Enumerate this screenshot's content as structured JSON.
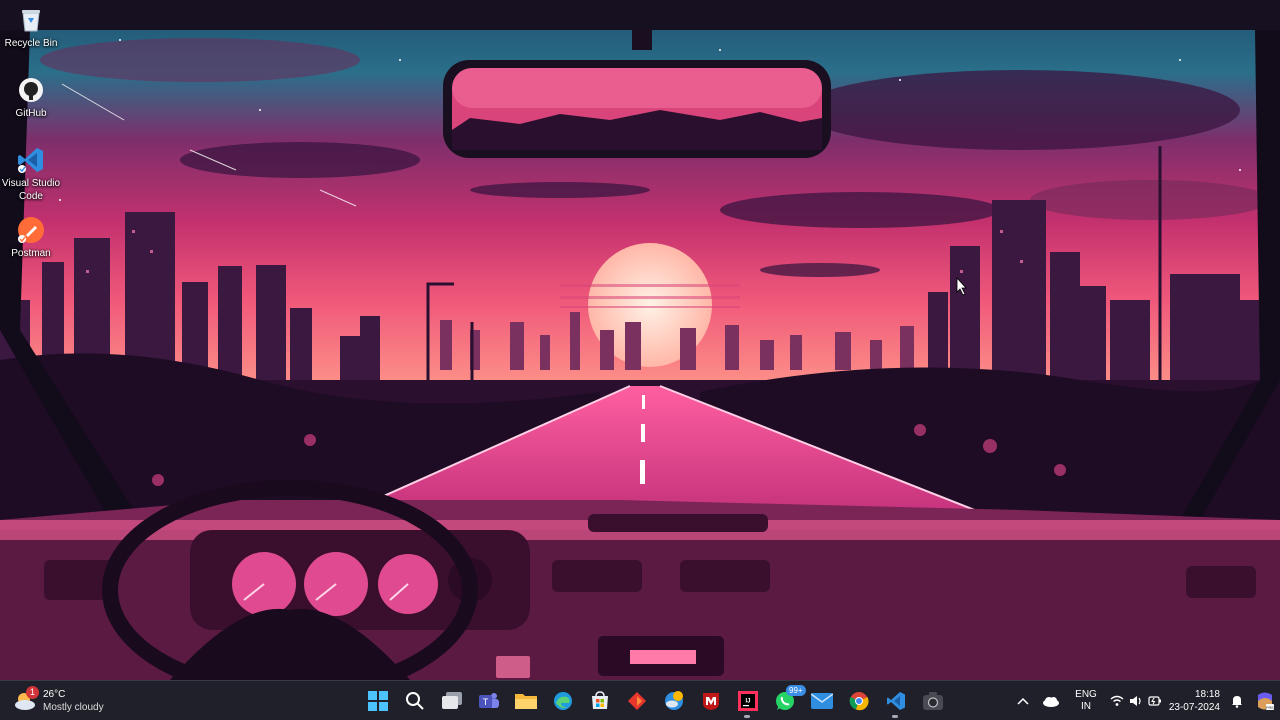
{
  "desktop": {
    "icons": [
      {
        "label": "Recycle Bin",
        "icon": "recycle-bin-icon"
      },
      {
        "label": "GitHub",
        "icon": "github-icon"
      },
      {
        "label": "Visual Studio Code",
        "icon": "vscode-icon"
      },
      {
        "label": "Postman",
        "icon": "postman-icon"
      }
    ],
    "wallpaper": "synthwave-car-dashboard-sunset"
  },
  "taskbar": {
    "weather": {
      "temp": "26°C",
      "desc": "Mostly cloudy",
      "badge": "1"
    },
    "apps": [
      {
        "name": "Start",
        "icon": "windows-start-icon"
      },
      {
        "name": "Search",
        "icon": "search-icon"
      },
      {
        "name": "Task View",
        "icon": "task-view-icon"
      },
      {
        "name": "Teams",
        "icon": "teams-icon"
      },
      {
        "name": "File Explorer",
        "icon": "file-explorer-icon"
      },
      {
        "name": "Edge",
        "icon": "edge-icon"
      },
      {
        "name": "Microsoft Store",
        "icon": "store-icon"
      },
      {
        "name": "Git App",
        "icon": "red-diamond-app-icon"
      },
      {
        "name": "Weather App",
        "icon": "weather-app-icon"
      },
      {
        "name": "McAfee",
        "icon": "mcafee-icon"
      },
      {
        "name": "IntelliJ IDEA",
        "icon": "intellij-icon"
      },
      {
        "name": "WhatsApp",
        "icon": "whatsapp-icon",
        "count": "99+"
      },
      {
        "name": "Mail",
        "icon": "mail-icon"
      },
      {
        "name": "Chrome",
        "icon": "chrome-icon"
      },
      {
        "name": "VS Code",
        "icon": "vscode-taskbar-icon"
      },
      {
        "name": "Camera",
        "icon": "camera-icon"
      }
    ],
    "tray": {
      "lang_line1": "ENG",
      "lang_line2": "IN",
      "time": "18:18",
      "date": "23-07-2024"
    }
  },
  "colors": {
    "taskbar_bg": "#20202a",
    "accent": "#3a8ee6",
    "sky_top": "#2a6f8a",
    "sky_mid": "#c2306e",
    "sun": "#ffd6c8"
  }
}
